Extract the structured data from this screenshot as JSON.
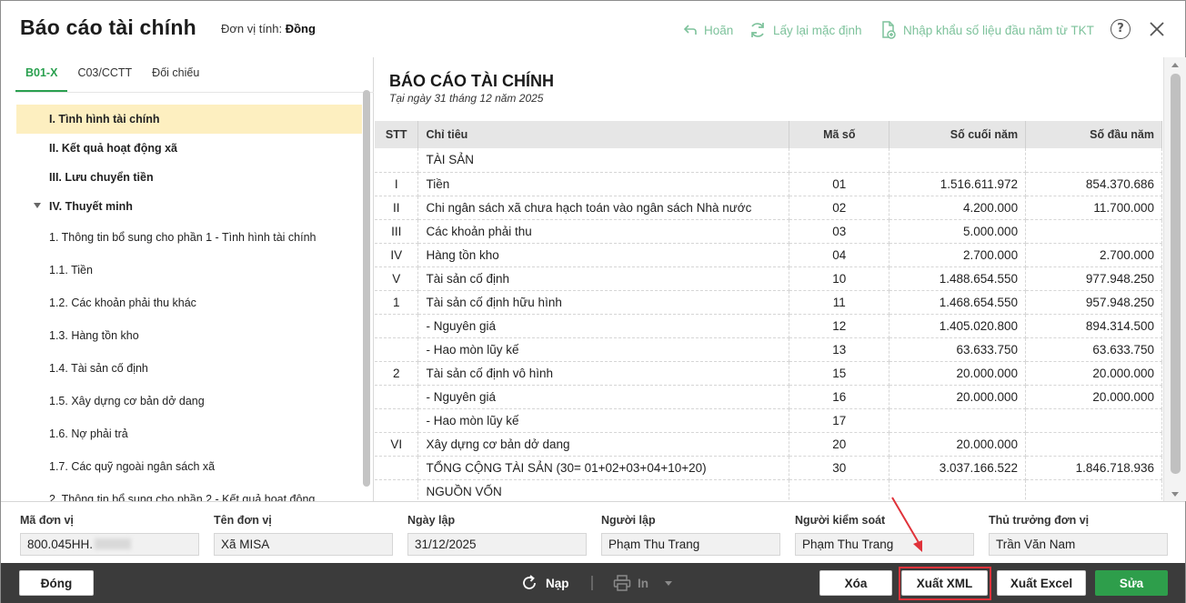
{
  "header": {
    "title": "Báo cáo tài chính",
    "unit_label": "Đơn vị tính:",
    "unit_value": "Đồng",
    "undo_label": "Hoãn",
    "default_label": "Lấy lại mặc định",
    "import_label": "Nhập khẩu số liệu đầu năm từ TKT",
    "help_label": "?"
  },
  "tabs": [
    "B01-X",
    "C03/CCTT",
    "Đối chiếu"
  ],
  "tree": [
    {
      "label": "I. Tình hình tài chính",
      "level": 0,
      "selected": true
    },
    {
      "label": "II. Kết quả hoạt động xã",
      "level": 0
    },
    {
      "label": "III. Lưu chuyển tiền",
      "level": 0
    },
    {
      "label": "IV. Thuyết minh",
      "level": 0,
      "expanded": true
    },
    {
      "label": "1. Thông tin bổ sung cho phần 1 - Tình hình tài chính",
      "level": 1
    },
    {
      "label": "1.1. Tiền",
      "level": 1
    },
    {
      "label": "1.2. Các khoản phải thu khác",
      "level": 1
    },
    {
      "label": "1.3. Hàng tồn kho",
      "level": 1
    },
    {
      "label": "1.4. Tài sản cố định",
      "level": 1
    },
    {
      "label": "1.5. Xây dựng cơ bản dở dang",
      "level": 1
    },
    {
      "label": "1.6. Nợ phải trả",
      "level": 1
    },
    {
      "label": "1.7. Các quỹ ngoài ngân sách xã",
      "level": 1
    },
    {
      "label": "2. Thông tin bổ sung cho phần 2 - Kết quả hoạt động",
      "level": 1
    }
  ],
  "report": {
    "title": "BÁO CÁO TÀI CHÍNH",
    "date": "Tại ngày 31 tháng 12 năm 2025",
    "columns": [
      "STT",
      "Chỉ tiêu",
      "Mã số",
      "Số cuối năm",
      "Số đầu năm"
    ],
    "rows": [
      {
        "stt": "",
        "name": "TÀI SẢN",
        "code": "",
        "end": "",
        "begin": ""
      },
      {
        "stt": "I",
        "name": "Tiền",
        "code": "01",
        "end": "1.516.611.972",
        "begin": "854.370.686"
      },
      {
        "stt": "II",
        "name": "Chi ngân sách xã chưa hạch toán vào ngân sách Nhà nước",
        "code": "02",
        "end": "4.200.000",
        "begin": "11.700.000"
      },
      {
        "stt": "III",
        "name": "Các khoản phải thu",
        "code": "03",
        "end": "5.000.000",
        "begin": ""
      },
      {
        "stt": "IV",
        "name": "Hàng tồn kho",
        "code": "04",
        "end": "2.700.000",
        "begin": "2.700.000"
      },
      {
        "stt": "V",
        "name": "Tài sản cố định",
        "code": "10",
        "end": "1.488.654.550",
        "begin": "977.948.250"
      },
      {
        "stt": "1",
        "name": "Tài sản cố định hữu hình",
        "code": "11",
        "end": "1.468.654.550",
        "begin": "957.948.250"
      },
      {
        "stt": "",
        "name": "- Nguyên giá",
        "code": "12",
        "end": "1.405.020.800",
        "begin": "894.314.500"
      },
      {
        "stt": "",
        "name": "- Hao mòn lũy kế",
        "code": "13",
        "end": "63.633.750",
        "begin": "63.633.750"
      },
      {
        "stt": "2",
        "name": "Tài sản cố định vô hình",
        "code": "15",
        "end": "20.000.000",
        "begin": "20.000.000"
      },
      {
        "stt": "",
        "name": "- Nguyên giá",
        "code": "16",
        "end": "20.000.000",
        "begin": "20.000.000"
      },
      {
        "stt": "",
        "name": "- Hao mòn lũy kế",
        "code": "17",
        "end": "",
        "begin": ""
      },
      {
        "stt": "VI",
        "name": "Xây dựng cơ bản dở dang",
        "code": "20",
        "end": "20.000.000",
        "begin": ""
      },
      {
        "stt": "",
        "name": "TỔNG CỘNG TÀI SẢN (30= 01+02+03+04+10+20)",
        "code": "30",
        "end": "3.037.166.522",
        "begin": "1.846.718.936"
      },
      {
        "stt": "",
        "name": "NGUỒN VỐN",
        "code": "",
        "end": "",
        "begin": ""
      }
    ]
  },
  "info": {
    "unit_code_label": "Mã đơn vị",
    "unit_code_value": "800.045HH.",
    "unit_name_label": "Tên đơn vị",
    "unit_name_value": "Xã MISA",
    "date_label": "Ngày lập",
    "date_value": "31/12/2025",
    "preparer_label": "Người lập",
    "preparer_value": "Phạm Thu Trang",
    "checker_label": "Người kiểm soát",
    "checker_value": "Phạm Thu Trang",
    "head_label": "Thủ trưởng đơn vị",
    "head_value": "Trần Văn Nam"
  },
  "footer": {
    "close_label": "Đóng",
    "reload_label": "Nạp",
    "print_label": "In",
    "delete_label": "Xóa",
    "export_xml_label": "Xuất XML",
    "export_excel_label": "Xuất Excel",
    "edit_label": "Sửa"
  },
  "colors": {
    "accent": "#2aa04f",
    "header_action": "#7dc29b",
    "selected_row": "#fdefc0",
    "footer_bg": "#3b3b3b",
    "highlight": "#e0323a"
  }
}
